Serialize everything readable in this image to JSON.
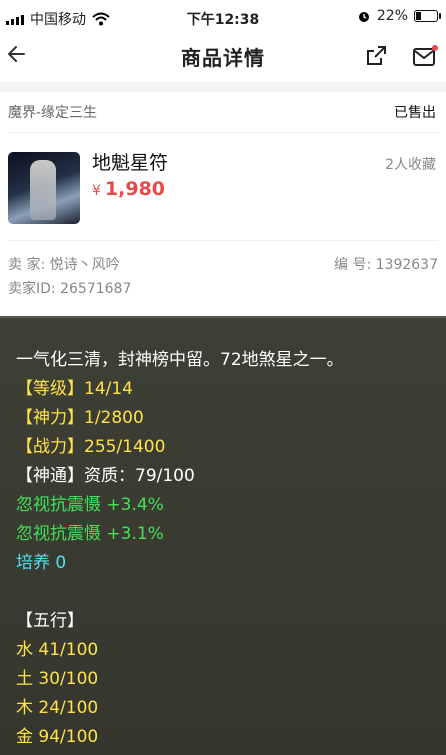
{
  "status_bar": {
    "carrier": "中国移动",
    "time": "下午12:38",
    "battery": "22%",
    "battery_level": 0.22
  },
  "nav": {
    "title": "商品详情"
  },
  "listing": {
    "server": "魔界-缘定三生",
    "status": "已售出",
    "item_name": "地魁星符",
    "currency": "¥",
    "price": "1,980",
    "favorites": "2人收藏",
    "seller_label": "卖 家:",
    "seller_name": "悦诗丶风吟",
    "serial_label": "编 号:",
    "serial": "1392637",
    "seller_id_label": "卖家ID:",
    "seller_id": "26571687"
  },
  "description": {
    "intro": "一气化三清，封神榜中留。72地煞星之一。",
    "level": "【等级】14/14",
    "spirit": "【神力】1/2800",
    "power": "【战力】255/1400",
    "ability": "【神通】资质：79/100",
    "bonus1": "忽视抗震慑 +3.4%",
    "bonus2": "忽视抗震慑 +3.1%",
    "cultivate": "培养 0",
    "wuxing_title": "【五行】",
    "water": "水 41/100",
    "earth": "土 30/100",
    "wood": "木 24/100",
    "metal": "金 94/100"
  },
  "colors": {
    "price": "#e84a4a",
    "panel_bg": "#3b3c32",
    "stat_yellow": "#ffe24a",
    "bonus_green": "#43e05a",
    "cultivate_cyan": "#4fe1f3"
  },
  "icons": [
    "signal-icon",
    "wifi-icon",
    "alarm-icon",
    "battery-icon",
    "back-arrow-icon",
    "share-icon",
    "mail-icon"
  ]
}
